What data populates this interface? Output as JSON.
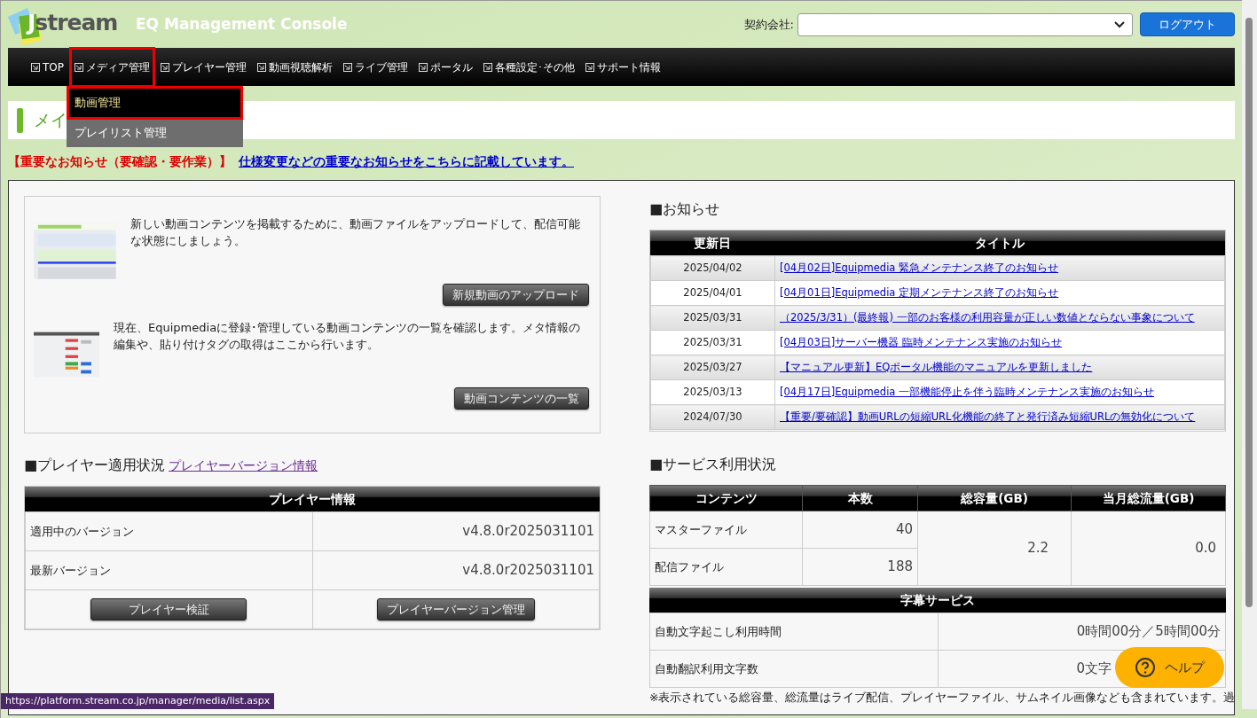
{
  "header": {
    "logo": "Jstream",
    "title": "EQ Management Console",
    "company_label": "契約会社:",
    "logout": "ログアウト"
  },
  "nav": [
    {
      "label": "TOP",
      "selected": false
    },
    {
      "label": "メディア管理",
      "selected": true
    },
    {
      "label": "プレイヤー管理",
      "selected": false
    },
    {
      "label": "動画視聴解析",
      "selected": false
    },
    {
      "label": "ライブ管理",
      "selected": false
    },
    {
      "label": "ポータル",
      "selected": false
    },
    {
      "label": "各種設定･その他",
      "selected": false
    },
    {
      "label": "サポート情報",
      "selected": false
    }
  ],
  "dropdown": [
    {
      "label": "動画管理",
      "selected": true
    },
    {
      "label": "プレイリスト管理",
      "selected": false
    }
  ],
  "page_heading": "メイ",
  "notice": {
    "label": "【重要なお知らせ（要確認・要作業）】",
    "link": "仕様変更などの重要なお知らせをこちらに記載しています。"
  },
  "media_actions": [
    {
      "text": "新しい動画コンテンツを掲載するために、動画ファイルをアップロードして、配信可能な状態にしましょう。",
      "button": "新規動画のアップロード"
    },
    {
      "text": "現在、Equipmediaに登録･管理している動画コンテンツの一覧を確認します。メタ情報の編集や、貼り付けタグの取得はここから行います。",
      "button": "動画コンテンツの一覧"
    }
  ],
  "player": {
    "heading": "■プレイヤー適用状況",
    "link": "プレイヤーバージョン情報",
    "table_title": "プレイヤー情報",
    "rows": [
      {
        "label": "適用中のバージョン",
        "value": "v4.8.0r2025031101"
      },
      {
        "label": "最新バージョン",
        "value": "v4.8.0r2025031101"
      }
    ],
    "buttons": [
      "プレイヤー検証",
      "プレイヤーバージョン管理"
    ]
  },
  "news": {
    "heading": "■お知らせ",
    "columns": [
      "更新日",
      "タイトル"
    ],
    "rows": [
      {
        "date": "2025/04/02",
        "title": "[04月02日]Equipmedia 緊急メンテナンス終了のお知らせ"
      },
      {
        "date": "2025/04/01",
        "title": "[04月01日]Equipmedia 定期メンテナンス終了のお知らせ"
      },
      {
        "date": "2025/03/31",
        "title": "（2025/3/31）(最終報) 一部のお客様の利用容量が正しい数値とならない事象について"
      },
      {
        "date": "2025/03/31",
        "title": "[04月03日]サーバー機器 臨時メンテナンス実施のお知らせ"
      },
      {
        "date": "2025/03/27",
        "title": "【マニュアル更新】EQポータル機能のマニュアルを更新しました"
      },
      {
        "date": "2025/03/13",
        "title": "[04月17日]Equipmedia 一部機能停止を伴う臨時メンテナンス実施のお知らせ"
      },
      {
        "date": "2024/07/30",
        "title": "【重要/要確認】動画URLの短縮URL化機能の終了と発行済み短縮URLの無効化について"
      }
    ]
  },
  "usage": {
    "heading": "■サービス利用状況",
    "columns": [
      "コンテンツ",
      "本数",
      "総容量(GB)",
      "当月総流量(GB)"
    ],
    "rows": [
      {
        "name": "マスターファイル",
        "count": "40"
      },
      {
        "name": "配信ファイル",
        "count": "188"
      }
    ],
    "total": "2.2",
    "monthly": "0.0",
    "caption_title": "字幕サービス",
    "caption_rows": [
      {
        "label": "自動文字起こし利用時間",
        "value": "0時間00分／5時間00分"
      },
      {
        "label": "自動翻訳利用文字数",
        "value": "0文字"
      }
    ],
    "footnote": "※表示されている総容量、総流量はライブ配信、プレイヤーファイル、サムネイル画像なども含まれています。過"
  },
  "help": "ヘルプ",
  "status_url": "https://platform.stream.co.jp/manager/media/list.aspx"
}
